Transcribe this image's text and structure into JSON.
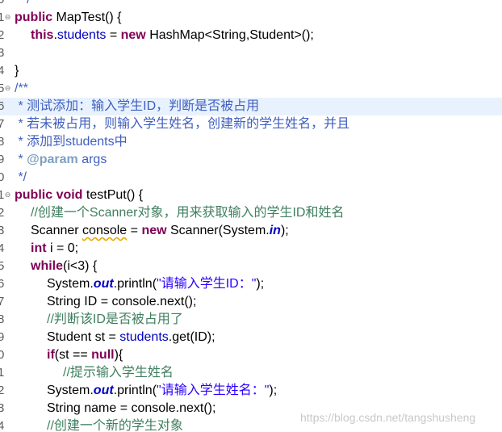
{
  "editor": {
    "lines": [
      {
        "num": "0",
        "fold": "",
        "indent": 0,
        "tokens": [
          {
            "t": "  */",
            "c": "jd"
          }
        ]
      },
      {
        "num": "1",
        "fold": "⊖",
        "indent": 0,
        "tokens": [
          {
            "t": "public",
            "c": "kw"
          },
          {
            "t": " MapTest() {",
            "c": ""
          }
        ]
      },
      {
        "num": "2",
        "fold": "",
        "indent": 1,
        "tokens": [
          {
            "t": "this",
            "c": "kw"
          },
          {
            "t": ".",
            "c": ""
          },
          {
            "t": "students",
            "c": "fld"
          },
          {
            "t": " = ",
            "c": ""
          },
          {
            "t": "new",
            "c": "kw"
          },
          {
            "t": " HashMap<String,Student>();",
            "c": ""
          }
        ]
      },
      {
        "num": "3",
        "fold": "",
        "indent": 0,
        "tokens": []
      },
      {
        "num": "4",
        "fold": "",
        "indent": 0,
        "tokens": [
          {
            "t": "}",
            "c": ""
          }
        ]
      },
      {
        "num": "5",
        "fold": "⊖",
        "indent": 0,
        "tokens": [
          {
            "t": "/**",
            "c": "jd"
          }
        ]
      },
      {
        "num": "6",
        "fold": "",
        "indent": 0,
        "highlight": true,
        "tokens": [
          {
            "t": " * 测试添加：输入学生ID，判断是否被占用",
            "c": "jd"
          }
        ]
      },
      {
        "num": "7",
        "fold": "",
        "indent": 0,
        "tokens": [
          {
            "t": " * 若未被占用，则输入学生姓名，创建新的学生姓名，并且",
            "c": "jd"
          }
        ]
      },
      {
        "num": "8",
        "fold": "",
        "indent": 0,
        "tokens": [
          {
            "t": " * 添加到students中",
            "c": "jd"
          }
        ]
      },
      {
        "num": "9",
        "fold": "",
        "indent": 0,
        "tokens": [
          {
            "t": " * ",
            "c": "jd"
          },
          {
            "t": "@param",
            "c": "jdtag"
          },
          {
            "t": " args",
            "c": "jd"
          }
        ]
      },
      {
        "num": "0",
        "fold": "",
        "indent": 0,
        "tokens": [
          {
            "t": " */",
            "c": "jd"
          }
        ]
      },
      {
        "num": "1",
        "fold": "⊖",
        "indent": 0,
        "tokens": [
          {
            "t": "public",
            "c": "kw"
          },
          {
            "t": " ",
            "c": ""
          },
          {
            "t": "void",
            "c": "kw"
          },
          {
            "t": " testPut() {",
            "c": ""
          }
        ]
      },
      {
        "num": "2",
        "fold": "",
        "indent": 1,
        "tokens": [
          {
            "t": "//创建一个Scanner对象，用来获取输入的学生ID和姓名",
            "c": "cmt"
          }
        ]
      },
      {
        "num": "3",
        "fold": "",
        "indent": 1,
        "tokens": [
          {
            "t": "Scanner ",
            "c": ""
          },
          {
            "t": "console",
            "c": "warn"
          },
          {
            "t": " = ",
            "c": ""
          },
          {
            "t": "new",
            "c": "kw"
          },
          {
            "t": " Scanner(System.",
            "c": ""
          },
          {
            "t": "in",
            "c": "sfld"
          },
          {
            "t": ");",
            "c": ""
          }
        ]
      },
      {
        "num": "4",
        "fold": "",
        "indent": 1,
        "tokens": [
          {
            "t": "int",
            "c": "kw"
          },
          {
            "t": " i = 0;",
            "c": ""
          }
        ]
      },
      {
        "num": "5",
        "fold": "",
        "indent": 1,
        "tokens": [
          {
            "t": "while",
            "c": "kw"
          },
          {
            "t": "(i<3) {",
            "c": ""
          }
        ]
      },
      {
        "num": "6",
        "fold": "",
        "indent": 2,
        "tokens": [
          {
            "t": "System.",
            "c": ""
          },
          {
            "t": "out",
            "c": "sfld"
          },
          {
            "t": ".println(",
            "c": ""
          },
          {
            "t": "\"请输入学生ID：\"",
            "c": "str"
          },
          {
            "t": ");",
            "c": ""
          }
        ]
      },
      {
        "num": "7",
        "fold": "",
        "indent": 2,
        "tokens": [
          {
            "t": "String ID = console.next();",
            "c": ""
          }
        ]
      },
      {
        "num": "8",
        "fold": "",
        "indent": 2,
        "tokens": [
          {
            "t": "//判断该ID是否被占用了",
            "c": "cmt"
          }
        ]
      },
      {
        "num": "9",
        "fold": "",
        "indent": 2,
        "tokens": [
          {
            "t": "Student st = ",
            "c": ""
          },
          {
            "t": "students",
            "c": "fld"
          },
          {
            "t": ".get(ID);",
            "c": ""
          }
        ]
      },
      {
        "num": "0",
        "fold": "",
        "indent": 2,
        "tokens": [
          {
            "t": "if",
            "c": "kw"
          },
          {
            "t": "(st == ",
            "c": ""
          },
          {
            "t": "null",
            "c": "kw"
          },
          {
            "t": "){",
            "c": ""
          }
        ]
      },
      {
        "num": "1",
        "fold": "",
        "indent": 3,
        "tokens": [
          {
            "t": "//提示输入学生姓名",
            "c": "cmt"
          }
        ]
      },
      {
        "num": "2",
        "fold": "",
        "indent": 2,
        "tokens": [
          {
            "t": "System.",
            "c": ""
          },
          {
            "t": "out",
            "c": "sfld"
          },
          {
            "t": ".println(",
            "c": ""
          },
          {
            "t": "\"请输入学生姓名：\"",
            "c": "str"
          },
          {
            "t": ");",
            "c": ""
          }
        ]
      },
      {
        "num": "3",
        "fold": "",
        "indent": 2,
        "tokens": [
          {
            "t": "String name = console.next();",
            "c": ""
          }
        ]
      },
      {
        "num": "4",
        "fold": "",
        "indent": 2,
        "tokens": [
          {
            "t": "//创建一个新的学生对象",
            "c": "cmt"
          }
        ]
      }
    ]
  },
  "watermark": "https://blog.csdn.net/tangshusheng",
  "colors": {
    "keyword": "#7f0055",
    "field": "#0000c0",
    "string": "#2a00ff",
    "comment": "#3f7f5f",
    "javadoc": "#3f5fbf",
    "javadoc_tag": "#7f9fbf",
    "current_line": "#e8f2fe"
  }
}
